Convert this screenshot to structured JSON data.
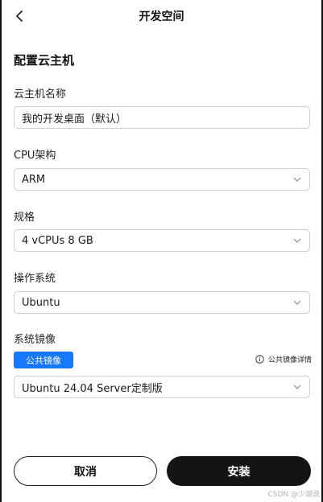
{
  "header": {
    "title": "开发空间",
    "back_icon": "chevron-left-icon"
  },
  "section": {
    "title": "配置云主机"
  },
  "fields": {
    "name": {
      "label": "云主机名称",
      "value": "我的开发桌面（默认）"
    },
    "cpu_arch": {
      "label": "CPU架构",
      "value": "ARM"
    },
    "spec": {
      "label": "规格",
      "value": "4 vCPUs 8 GB"
    },
    "os": {
      "label": "操作系统",
      "value": "Ubuntu"
    },
    "image": {
      "label": "系统镜像",
      "tag": "公共镜像",
      "detail_link": "公共镜像详情",
      "value": "Ubuntu 24.04 Server定制版"
    }
  },
  "actions": {
    "cancel": "取消",
    "install": "安装"
  },
  "watermark": "CSDN @少湖说",
  "colors": {
    "accent": "#1677ff",
    "primary_button": "#141414"
  }
}
